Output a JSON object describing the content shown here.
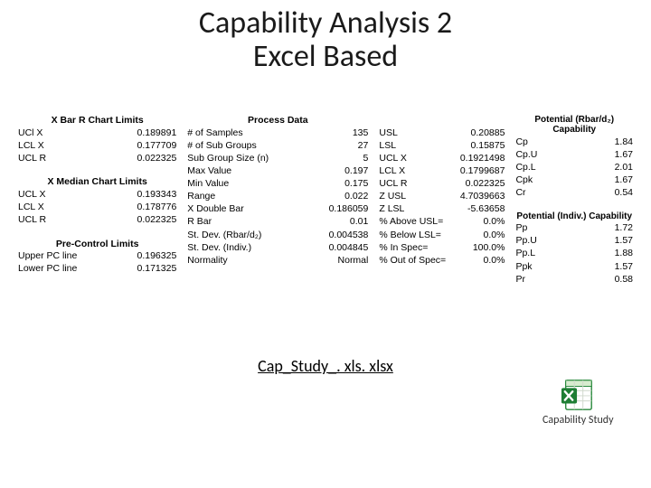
{
  "title_line1": "Capability Analysis 2",
  "title_line2": "Excel Based",
  "col1": {
    "heading1": "X Bar R Chart Limits",
    "rows1": [
      {
        "label": "UCl  X",
        "value": "0.189891"
      },
      {
        "label": "LCL X",
        "value": "0.177709"
      },
      {
        "label": "UCL R",
        "value": "0.022325"
      }
    ],
    "heading2": "X Median Chart Limits",
    "rows2": [
      {
        "label": "UCL X",
        "value": "0.193343"
      },
      {
        "label": "LCL X",
        "value": "0.178776"
      },
      {
        "label": "UCL R",
        "value": "0.022325"
      }
    ],
    "heading3": "Pre-Control Limits",
    "rows3": [
      {
        "label": "Upper PC line",
        "value": "0.196325"
      },
      {
        "label": "Lower PC line",
        "value": "0.171325"
      }
    ]
  },
  "col2": {
    "heading": "Process Data",
    "rows": [
      {
        "label": "# of Samples",
        "value": "135"
      },
      {
        "label": "# of Sub Groups",
        "value": "27"
      },
      {
        "label": "Sub Group Size (n)",
        "value": "5"
      },
      {
        "label": "Max Value",
        "value": "0.197"
      },
      {
        "label": "Min Value",
        "value": "0.175"
      },
      {
        "label": "Range",
        "value": "0.022"
      },
      {
        "label": "X Double Bar",
        "value": "0.186059"
      },
      {
        "label": "R Bar",
        "value": "0.01"
      },
      {
        "label": "St. Dev. (Rbar/d₂)",
        "value": "0.004538"
      },
      {
        "label": "St. Dev. (Indiv.)",
        "value": "0.004845"
      },
      {
        "label": "Normality",
        "value": "Normal"
      }
    ]
  },
  "col3": {
    "rows": [
      {
        "label": "USL",
        "value": "0.20885"
      },
      {
        "label": "LSL",
        "value": "0.15875"
      },
      {
        "label": "UCL X",
        "value": "0.1921498"
      },
      {
        "label": "LCL X",
        "value": "0.1799687"
      },
      {
        "label": "UCL R",
        "value": "0.022325"
      },
      {
        "label": "Z USL",
        "value": "4.7039663"
      },
      {
        "label": "Z LSL",
        "value": "-5.63658"
      },
      {
        "label": "% Above USL=",
        "value": "0.0%"
      },
      {
        "label": "% Below LSL=",
        "value": "0.0%"
      },
      {
        "label": "% In Spec=",
        "value": "100.0%"
      },
      {
        "label": "% Out of Spec=",
        "value": "0.0%"
      }
    ]
  },
  "col4": {
    "heading1": "Potential (Rbar/d₂) Capability",
    "rows1": [
      {
        "label": "Cp",
        "value": "1.84"
      },
      {
        "label": "Cp.U",
        "value": "1.67"
      },
      {
        "label": "Cp.L",
        "value": "2.01"
      },
      {
        "label": "Cpk",
        "value": "1.67"
      },
      {
        "label": "Cr",
        "value": "0.54"
      }
    ],
    "heading2": "Potential (Indiv.) Capability",
    "rows2": [
      {
        "label": "Pp",
        "value": "1.72"
      },
      {
        "label": "Pp.U",
        "value": "1.57"
      },
      {
        "label": "Pp.L",
        "value": "1.88"
      },
      {
        "label": "Ppk",
        "value": "1.57"
      },
      {
        "label": "Pr",
        "value": "0.58"
      }
    ]
  },
  "file_link": "Cap_Study_. xls. xlsx",
  "excel_caption": "Capability Study"
}
